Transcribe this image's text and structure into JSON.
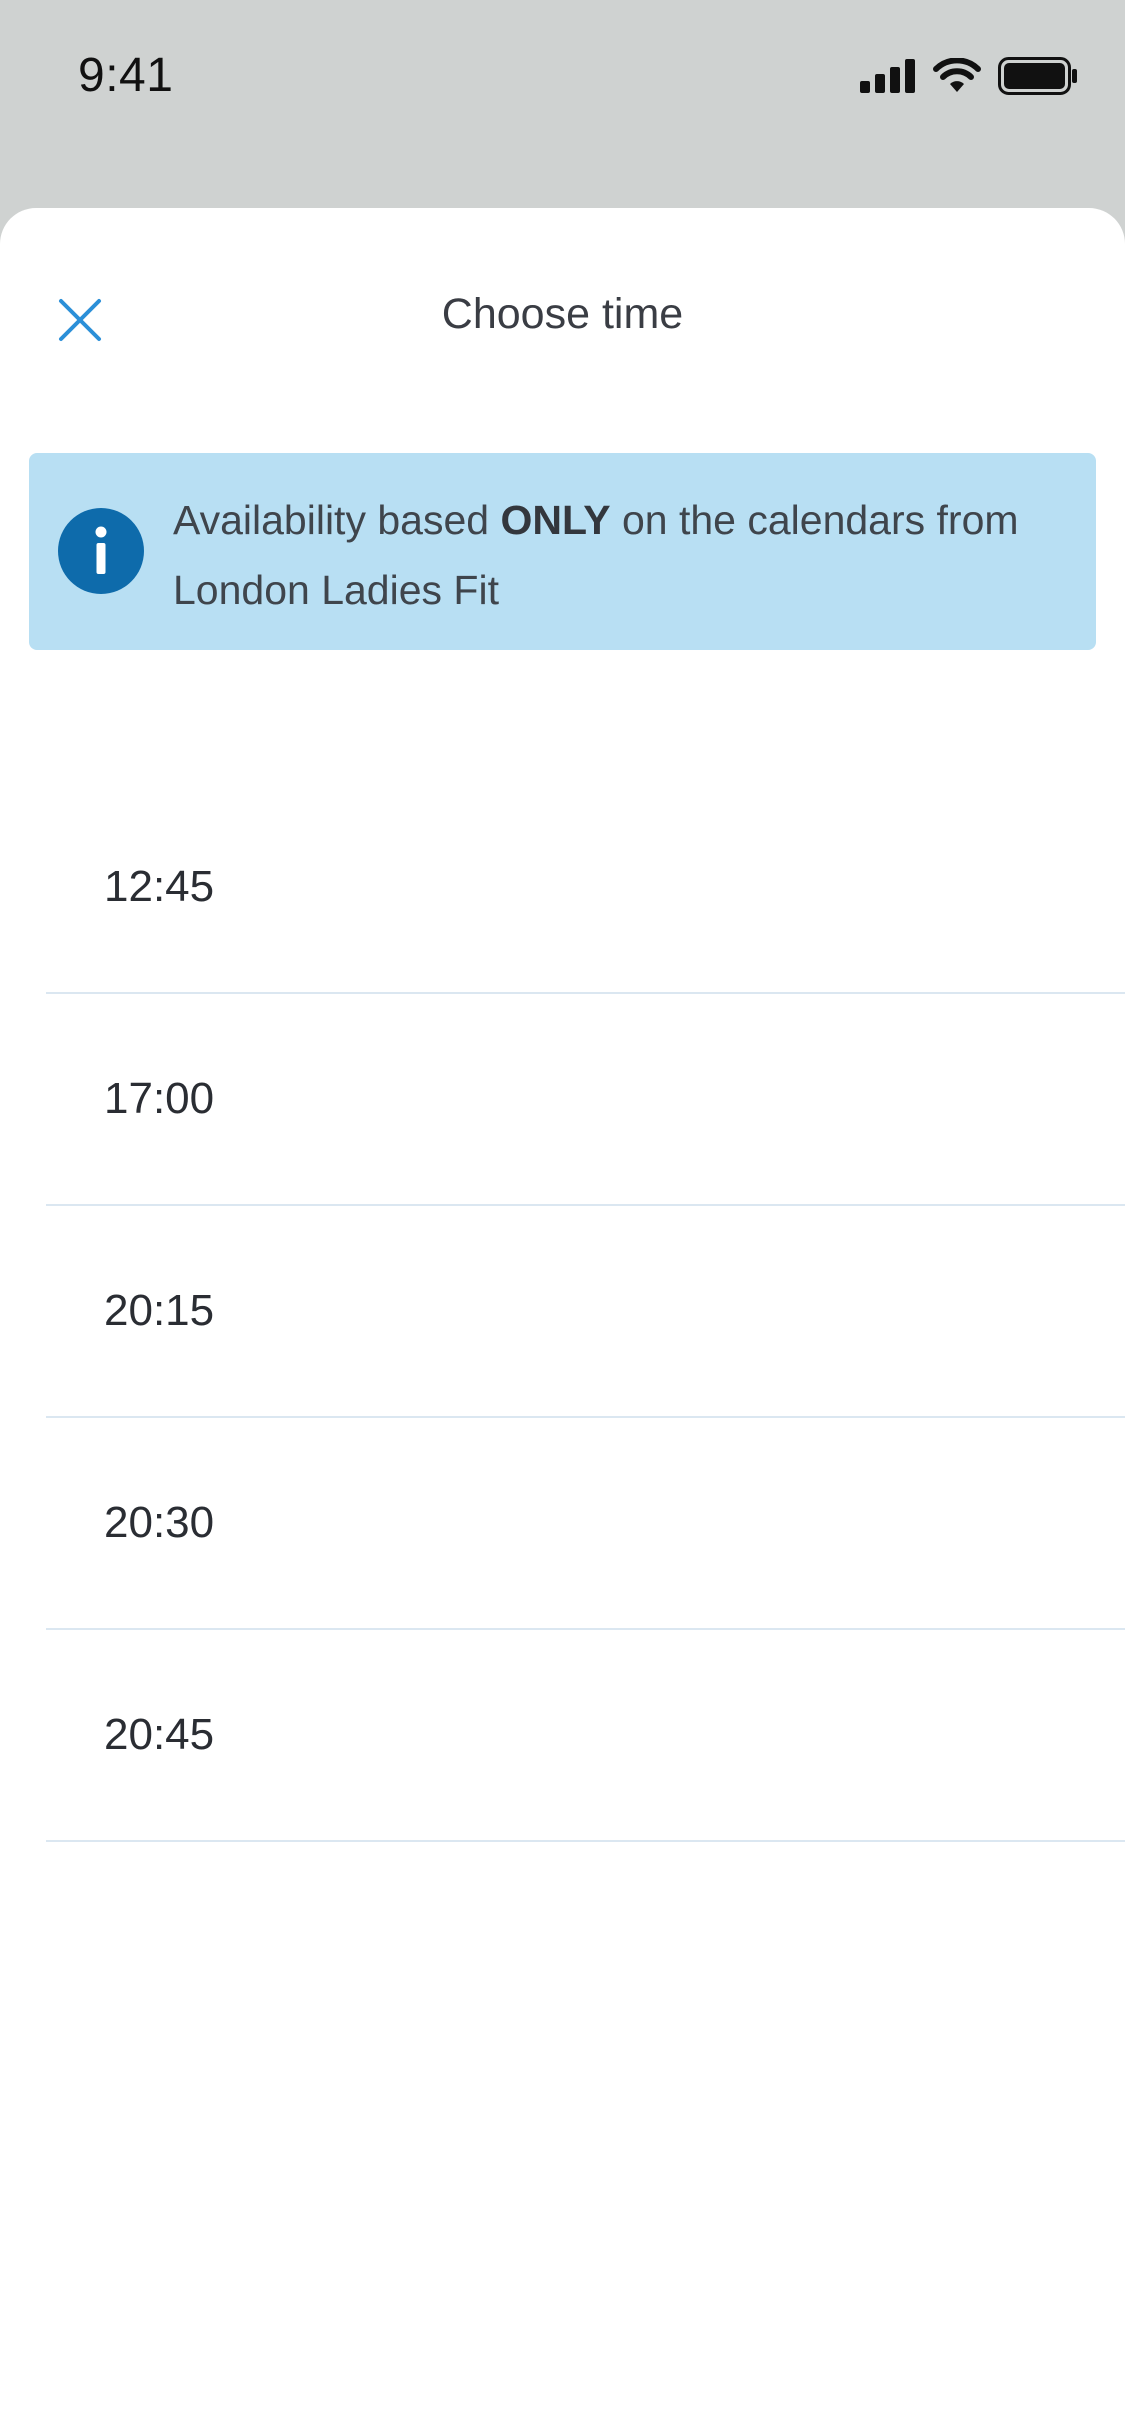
{
  "status_bar": {
    "time": "9:41",
    "icons": [
      "cellular-signal-icon",
      "wifi-icon",
      "battery-icon"
    ]
  },
  "sheet": {
    "title": "Choose time",
    "close_icon": "close-icon"
  },
  "info_banner": {
    "icon": "info-icon",
    "text_before": "Availability based ",
    "text_bold": "ONLY",
    "text_after": " on the calendars from  London Ladies Fit"
  },
  "times": [
    "12:45",
    "17:00",
    "20:15",
    "20:30",
    "20:45"
  ],
  "colors": {
    "accent": "#2b8fd8",
    "banner_bg": "#b8dff3",
    "info_icon": "#0e6bab",
    "divider": "#dbe7f1",
    "backdrop": "#cfd2d1"
  }
}
